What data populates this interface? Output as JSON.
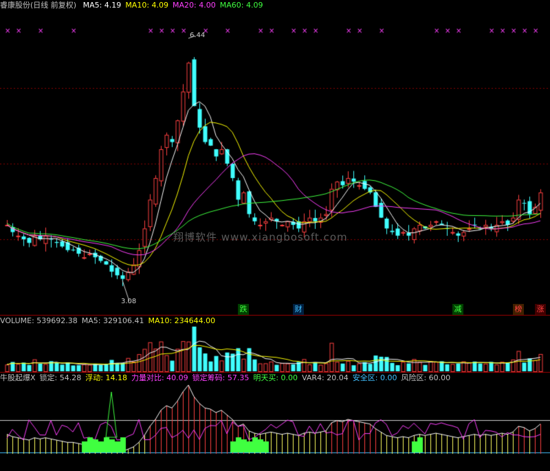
{
  "header": {
    "title": "睿康股份(日线 前复权)",
    "ma": [
      {
        "label": "MA5: 4.19",
        "color": "#ffffff"
      },
      {
        "label": "MA10: 4.09",
        "color": "#ffff00"
      },
      {
        "label": "MA20: 4.00",
        "color": "#ff40ff"
      },
      {
        "label": "MA60: 4.09",
        "color": "#40ff40"
      }
    ]
  },
  "volume_header": [
    {
      "label": "VOLUME: 539692.38",
      "color": "#c0c0c0"
    },
    {
      "label": "MA5: 329106.41",
      "color": "#c0c0c0"
    },
    {
      "label": "MA10: 234644.00",
      "color": "#ffff00"
    }
  ],
  "indicator_header": [
    {
      "label": "牛股起爆X",
      "color": "#c0c0c0"
    },
    {
      "label": "锁定: 54.28",
      "color": "#c0c0c0"
    },
    {
      "label": "浮动: 14.18",
      "color": "#ffff00"
    },
    {
      "label": "力量对比: 40.09",
      "color": "#ff40ff"
    },
    {
      "label": "锁定筹码: 57.35",
      "color": "#ff40ff"
    },
    {
      "label": "明天买: 0.00",
      "color": "#40ff40"
    },
    {
      "label": "VAR4: 20.04",
      "color": "#c0c0c0"
    },
    {
      "label": "安全区: 0.00",
      "color": "#40c0ff"
    },
    {
      "label": "风险区: 60.00",
      "color": "#c0c0c0"
    }
  ],
  "annotations": {
    "high": "6.44",
    "low": "3.08"
  },
  "watermark": "翔博软件 www.xiangbosoft.com",
  "signals": [
    {
      "text": "跌",
      "color": "#40ff40",
      "bg": "#004000",
      "idx": 43
    },
    {
      "text": "财",
      "color": "#40c0ff",
      "bg": "#002040",
      "idx": 53
    },
    {
      "text": "减",
      "color": "#40ff40",
      "bg": "#004000",
      "idx": 82
    },
    {
      "text": "榜",
      "color": "#ff4040",
      "bg": "#402000",
      "idx": 93
    },
    {
      "text": "涨",
      "color": "#ff4040",
      "bg": "#400000",
      "idx": 97
    }
  ],
  "colors": {
    "up": "#ff4040",
    "down": "#40ffff",
    "ma5": "#ffffff",
    "ma10": "#ffff00",
    "ma20": "#ff40ff",
    "ma60": "#40ff40",
    "grid": "#8b0000",
    "marker": "#ff40ff"
  },
  "chart_data": {
    "type": "candlestick",
    "title": "睿康股份(日线 前复权)",
    "ylim": [
      2.6,
      6.8
    ],
    "close": [
      3.85,
      3.75,
      3.7,
      3.65,
      3.6,
      3.7,
      3.65,
      3.7,
      3.65,
      3.6,
      3.55,
      3.5,
      3.5,
      3.45,
      3.4,
      3.45,
      3.4,
      3.35,
      3.3,
      3.2,
      3.15,
      3.1,
      3.2,
      3.3,
      3.5,
      3.8,
      4.2,
      4.5,
      4.9,
      5.1,
      5.0,
      5.3,
      5.7,
      6.1,
      5.5,
      5.2,
      5.0,
      4.95,
      4.8,
      4.9,
      4.7,
      4.5,
      4.2,
      4.3,
      4.0,
      3.9,
      3.85,
      3.9,
      3.95,
      3.9,
      3.85,
      3.9,
      3.85,
      3.8,
      3.9,
      3.95,
      3.9,
      3.95,
      4.0,
      4.35,
      4.45,
      4.4,
      4.5,
      4.45,
      4.4,
      4.35,
      4.3,
      4.1,
      3.95,
      3.8,
      3.75,
      3.7,
      3.75,
      3.7,
      3.8,
      3.85,
      3.8,
      3.85,
      3.9,
      3.85,
      3.8,
      3.75,
      3.7,
      3.75,
      3.8,
      3.85,
      3.8,
      3.85,
      3.8,
      3.85,
      3.9,
      3.85,
      3.95,
      4.2,
      4.15,
      4.0,
      4.1,
      4.3
    ],
    "ma_last": {
      "ma5": 4.19,
      "ma10": 4.09,
      "ma20": 4.0,
      "ma60": 4.09
    },
    "volume_last": 539692.38,
    "volume_ma5": 329106.41,
    "volume_ma10": 234644.0
  }
}
